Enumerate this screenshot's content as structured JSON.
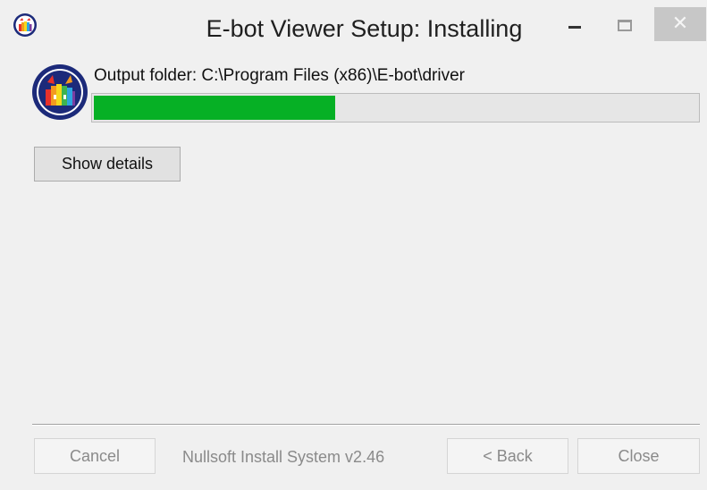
{
  "window": {
    "title": "E-bot Viewer Setup: Installing",
    "controls": {
      "minimize_icon": "minimize-icon",
      "maximize_icon": "maximize-icon",
      "close_glyph": "✕"
    }
  },
  "status": {
    "text": "Output folder: C:\\Program Files (x86)\\E-bot\\driver"
  },
  "progress": {
    "percent": 40
  },
  "buttons": {
    "show_details": "Show details",
    "cancel": "Cancel",
    "back": "< Back",
    "close": "Close"
  },
  "footer": {
    "brand": "Nullsoft Install System v2.46"
  },
  "colors": {
    "progress_fill": "#06b025",
    "progress_track": "#e6e6e6",
    "window_bg": "#f0f0f0",
    "close_hover": "#c7c7c7"
  },
  "icons": {
    "app": "ebot-app-icon"
  }
}
